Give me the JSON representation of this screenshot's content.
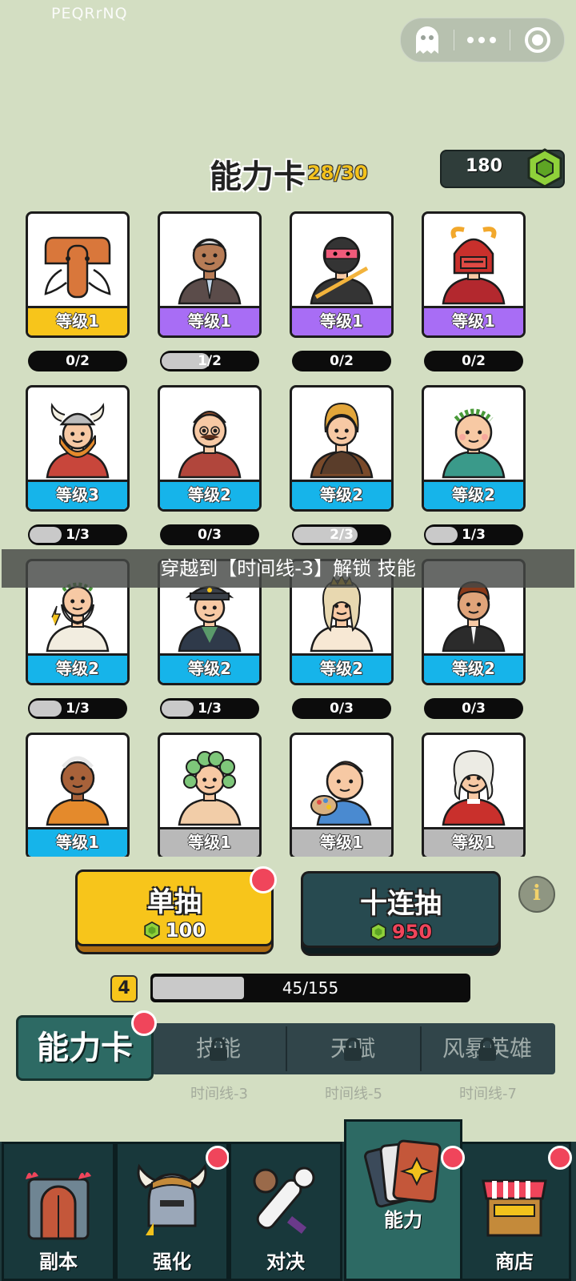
{
  "app_id": "PEQRrNQ",
  "header": {
    "title": "能力卡",
    "count": "28/30"
  },
  "currency": {
    "value": "180",
    "icon": "green-gem-icon"
  },
  "cards": [
    {
      "level": "等级1",
      "tier": "gold",
      "progress": "0/2",
      "fill": 0,
      "portrait": "mammoth"
    },
    {
      "level": "等级1",
      "tier": "purple",
      "progress": "1/2",
      "fill": 0.5,
      "portrait": "old-man-suit"
    },
    {
      "level": "等级1",
      "tier": "purple",
      "progress": "0/2",
      "fill": 0,
      "portrait": "ninja"
    },
    {
      "level": "等级1",
      "tier": "purple",
      "progress": "0/2",
      "fill": 0,
      "portrait": "samurai"
    },
    {
      "level": "等级3",
      "tier": "blue",
      "progress": "1/3",
      "fill": 0.33,
      "portrait": "viking"
    },
    {
      "level": "等级2",
      "tier": "blue",
      "progress": "0/3",
      "fill": 0,
      "portrait": "mustache-man"
    },
    {
      "level": "等级2",
      "tier": "blue",
      "progress": "2/3",
      "fill": 0.67,
      "portrait": "hunter"
    },
    {
      "level": "等级2",
      "tier": "blue",
      "progress": "1/3",
      "fill": 0.33,
      "portrait": "laurel-youth"
    },
    {
      "level": "等级2",
      "tier": "blue",
      "progress": "1/3",
      "fill": 0.33,
      "portrait": "zeus"
    },
    {
      "level": "等级2",
      "tier": "blue",
      "progress": "1/3",
      "fill": 0.33,
      "portrait": "admiral"
    },
    {
      "level": "等级2",
      "tier": "blue",
      "progress": "0/3",
      "fill": 0,
      "portrait": "queen"
    },
    {
      "level": "等级2",
      "tier": "blue",
      "progress": "0/3",
      "fill": 0,
      "portrait": "businessman"
    },
    {
      "level": "等级1",
      "tier": "blue",
      "progress": "",
      "fill": 0,
      "portrait": "monk"
    },
    {
      "level": "等级1",
      "tier": "grey",
      "progress": "",
      "fill": 0,
      "portrait": "medusa"
    },
    {
      "level": "等级1",
      "tier": "grey",
      "progress": "",
      "fill": 0,
      "portrait": "painter"
    },
    {
      "level": "等级1",
      "tier": "grey",
      "progress": "",
      "fill": 0,
      "portrait": "composer"
    }
  ],
  "toast": "穿越到【时间线-3】解锁 技能",
  "draw": {
    "single": {
      "label": "单抽",
      "cost": "100"
    },
    "ten": {
      "label": "十连抽",
      "cost": "950"
    }
  },
  "info_label": "i",
  "level": {
    "value": "4",
    "progress": "45/155",
    "fill": 0.29
  },
  "categories": {
    "active": "能力卡",
    "tabs": [
      {
        "label": "技能",
        "sub": "时间线-3"
      },
      {
        "label": "天赋",
        "sub": "时间线-5"
      },
      {
        "label": "风暴英雄",
        "sub": "时间线-7"
      }
    ]
  },
  "nav": [
    {
      "label": "副本",
      "icon": "dungeon-door-icon"
    },
    {
      "label": "强化",
      "icon": "helmet-icon"
    },
    {
      "label": "对决",
      "icon": "bone-club-icon"
    },
    {
      "label": "能力",
      "icon": "cards-icon"
    },
    {
      "label": "商店",
      "icon": "shop-stall-icon"
    }
  ],
  "colors": {
    "gold": "#f7c51b",
    "purple": "#a86df5",
    "blue": "#16b4ea",
    "grey": "#b9b9b9"
  }
}
